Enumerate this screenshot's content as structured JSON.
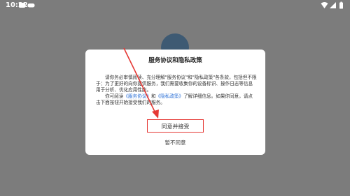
{
  "status_bar": {
    "time": "10:22"
  },
  "dialog": {
    "title": "服务协议和隐私政策",
    "paragraph1": "请你务必审慎阅读、充分理解\"服务协议\"和\"隐私政策\"各条款，包括但不限于：为了更好的向你提供服务，我们需要收集你的设备标识、操作日志等信息用于分析、优化应用性能。",
    "paragraph2_prefix": "你可阅读",
    "service_agreement_link": "《服务协议》",
    "paragraph2_and": "和",
    "privacy_policy_link": "《隐私政策》",
    "paragraph2_suffix": "了解详细信息。如果你同意，请点击下面按钮开始接受我们的服务。",
    "agree_label": "同意并接受",
    "disagree_label": "暂不同意"
  },
  "colors": {
    "overlay": "#7c7c7c",
    "link": "#2a6fd6",
    "highlight": "#e53935"
  }
}
